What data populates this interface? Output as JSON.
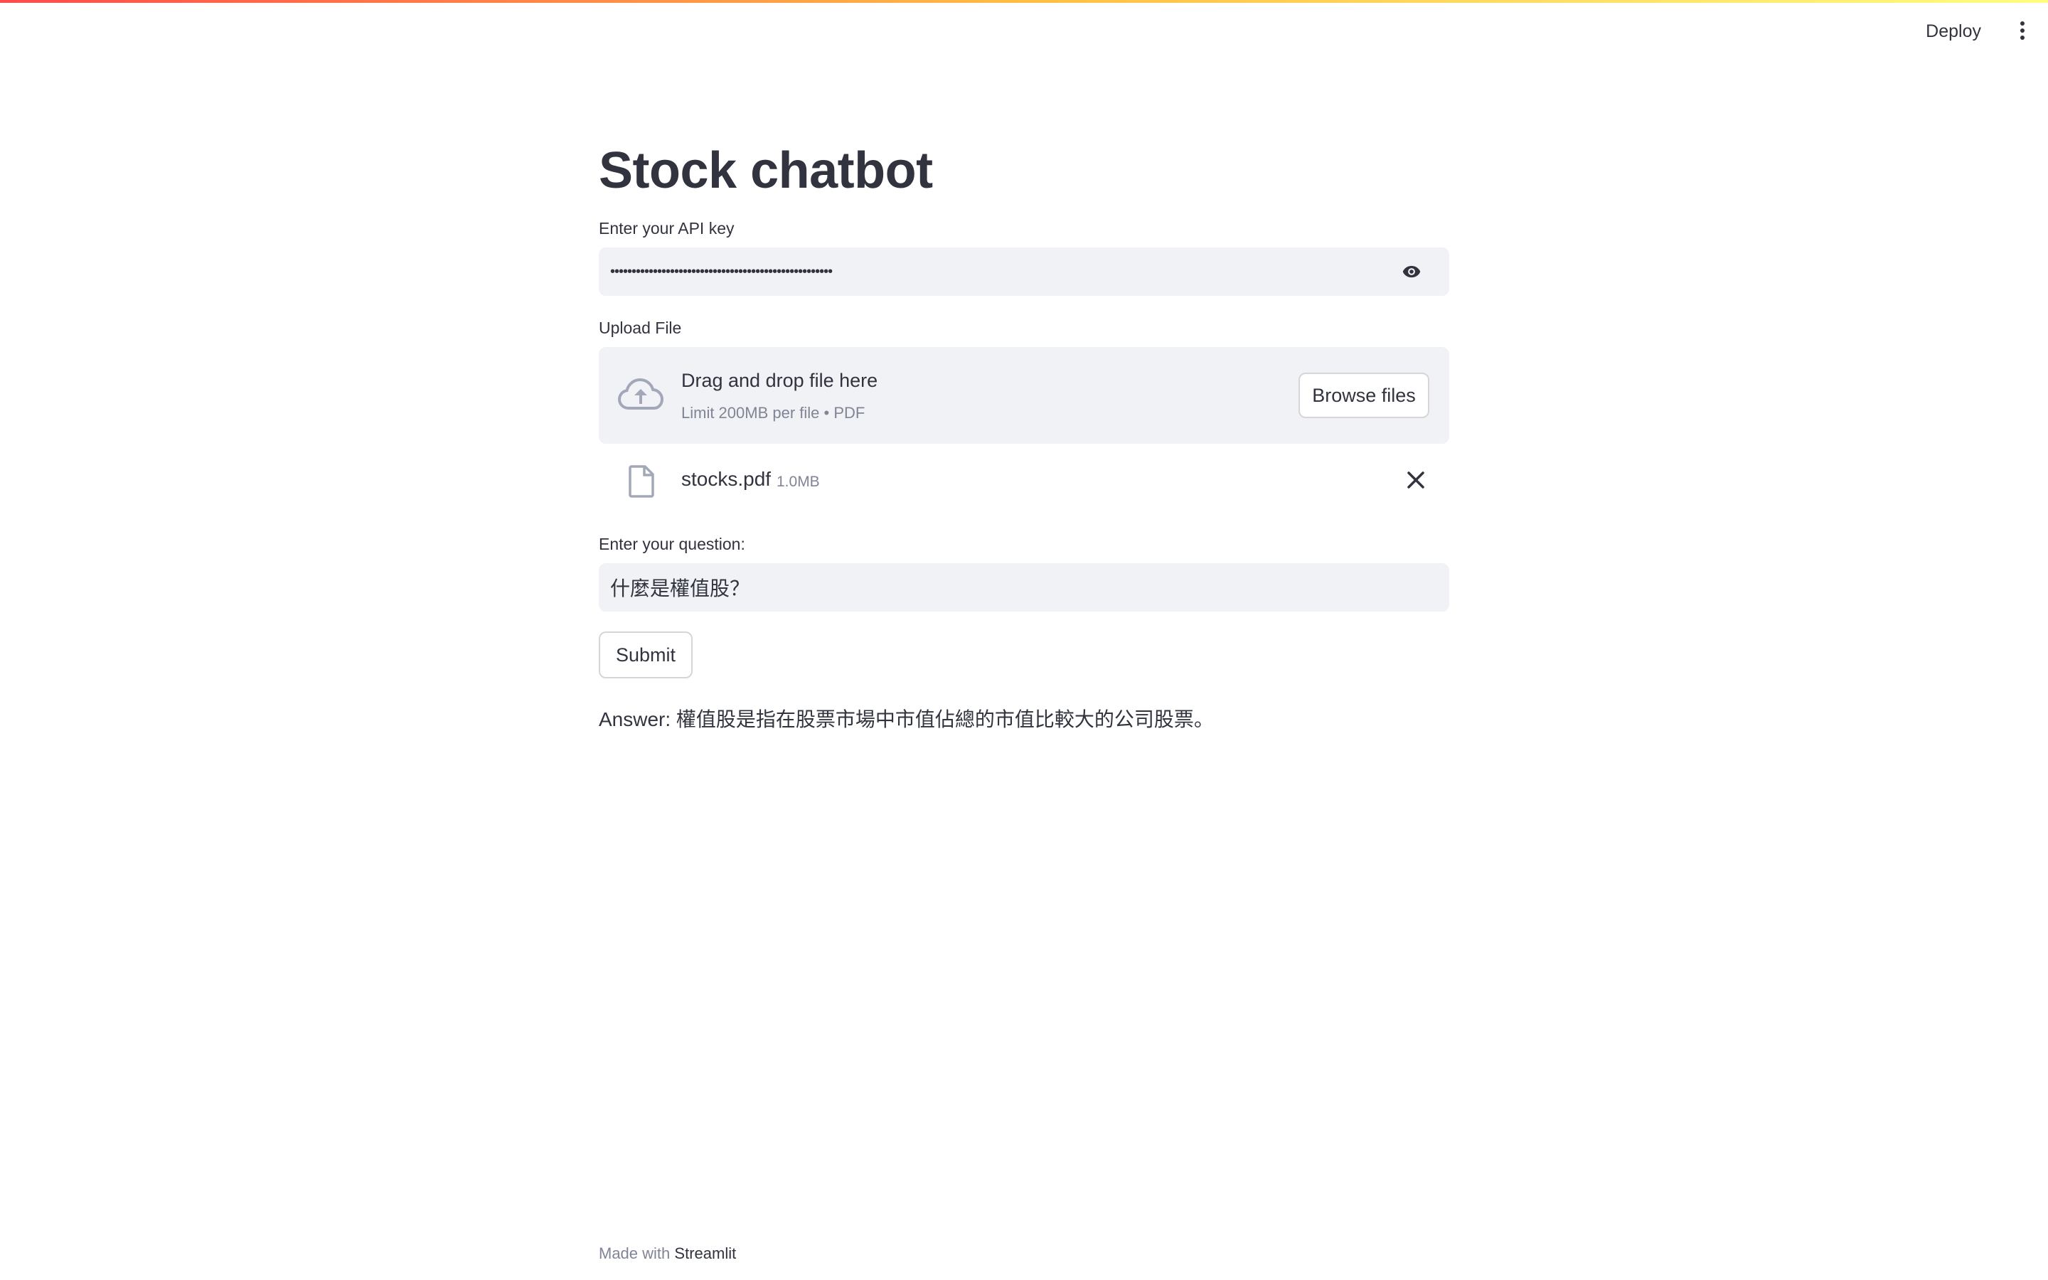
{
  "header": {
    "deploy_label": "Deploy",
    "menu_icon": "kebab-menu-icon"
  },
  "page": {
    "title": "Stock chatbot"
  },
  "api_key": {
    "label": "Enter your API key",
    "value": "••••••••••••••••••••••••••••••••••••••••••••••••••••",
    "toggle_icon": "eye-icon"
  },
  "upload": {
    "label": "Upload File",
    "drop_title": "Drag and drop file here",
    "drop_subtitle": "Limit 200MB per file • PDF",
    "browse_label": "Browse files",
    "icon": "cloud-upload-icon",
    "file": {
      "name": "stocks.pdf",
      "size": "1.0MB",
      "icon": "file-icon",
      "remove_icon": "close-icon"
    }
  },
  "question": {
    "label": "Enter your question:",
    "value": "什麼是權值股？"
  },
  "submit_label": "Submit",
  "answer_text": "Answer: 權值股是指在股票市場中市值佔總的市值比較大的公司股票。",
  "footer": {
    "prefix": "Made with",
    "brand": "Streamlit"
  },
  "colors": {
    "text": "#31333f",
    "muted": "#808495",
    "input_bg": "#f0f2f6",
    "accent_start": "#ff4b4b",
    "accent_end": "#fffd80"
  }
}
